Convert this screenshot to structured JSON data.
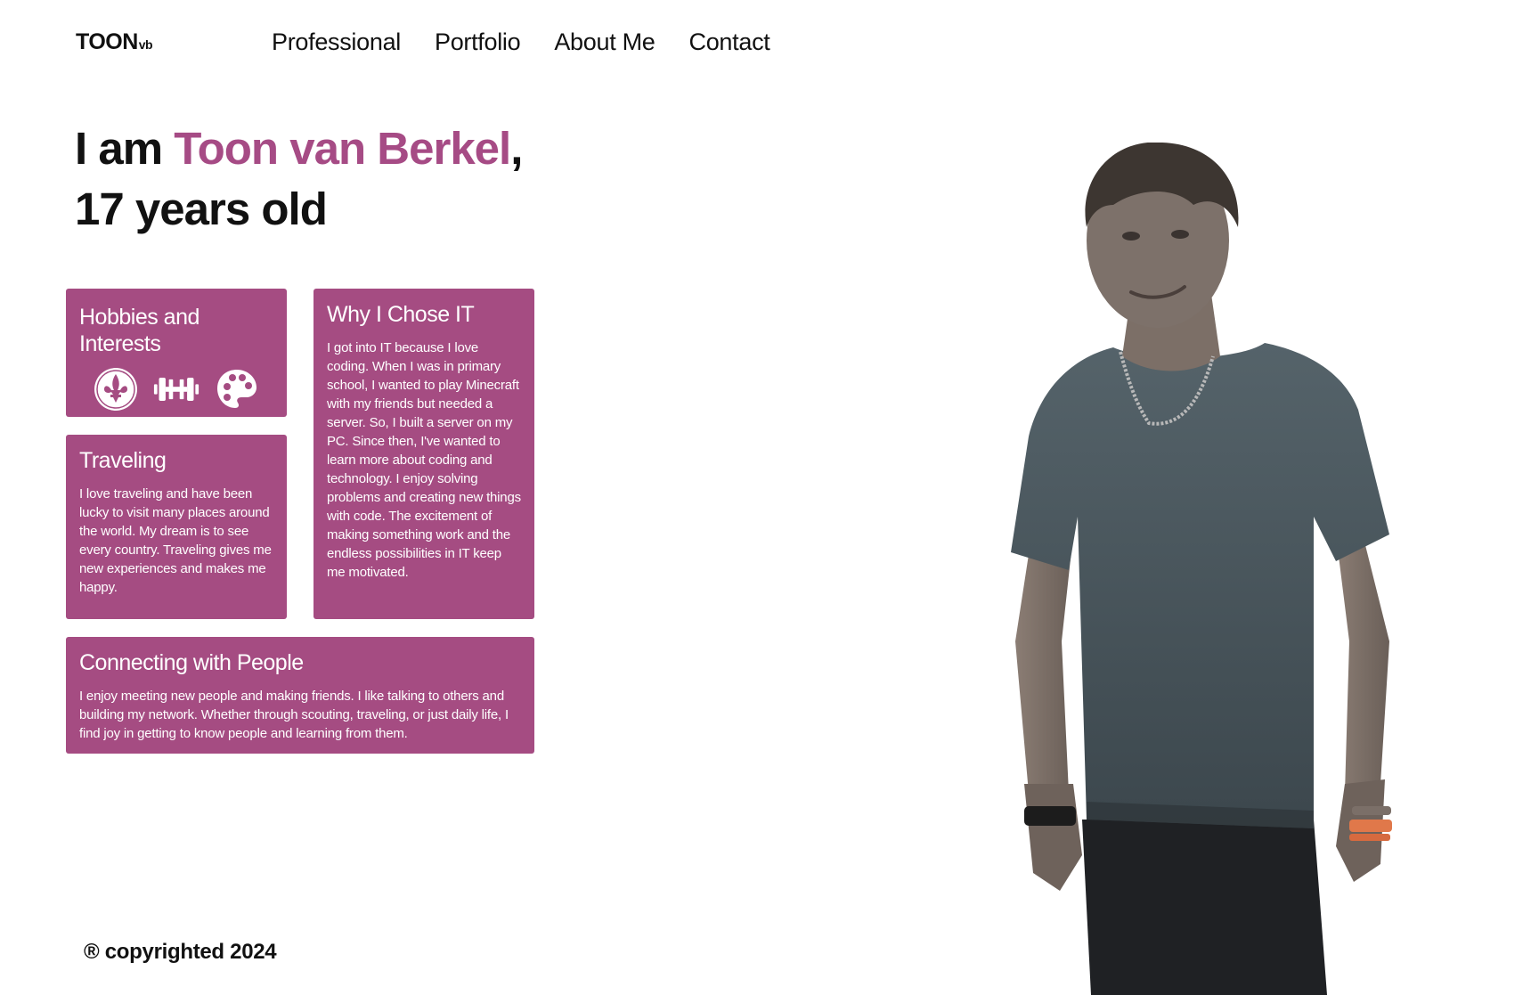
{
  "header": {
    "logo_main": "TOON",
    "logo_small": "vb",
    "nav": [
      "Professional",
      "Portfolio",
      "About Me",
      "Contact"
    ]
  },
  "hero": {
    "prefix": "I am ",
    "name": "Toon van Berkel",
    "comma": ",",
    "line2": "17 years old"
  },
  "cards": {
    "hobbies": {
      "title": "Hobbies and Interests",
      "items": [
        {
          "label": "Scouting",
          "icon": "scouting-fleur-de-lis-icon"
        },
        {
          "label": "Gym",
          "icon": "dumbbell-icon"
        },
        {
          "label": "Art",
          "icon": "palette-icon"
        }
      ]
    },
    "why": {
      "title": "Why I Chose IT",
      "text": "I got into IT because I love coding. When I was in primary school, I wanted to play Minecraft with my friends but needed a server. So, I built a server on my PC. Since then, I've wanted to learn more about coding and technology. I enjoy solving problems and creating new things with code. The excitement of making something work and the endless possibilities in IT keep me motivated."
    },
    "travel": {
      "title": "Traveling",
      "text": "I love traveling and have been lucky to visit many places around the world. My dream is to see every country. Traveling gives me new experiences and makes me happy."
    },
    "connect": {
      "title": "Connecting with People",
      "text": "I enjoy meeting new people and making friends. I like talking to others and building my network. Whether through scouting, traveling, or just daily life, I find joy in getting to know people and learning from them."
    }
  },
  "footer": {
    "text": "® copyrighted 2024"
  },
  "colors": {
    "accent": "#a64b85",
    "card": "#a54c82",
    "text": "#111111"
  }
}
